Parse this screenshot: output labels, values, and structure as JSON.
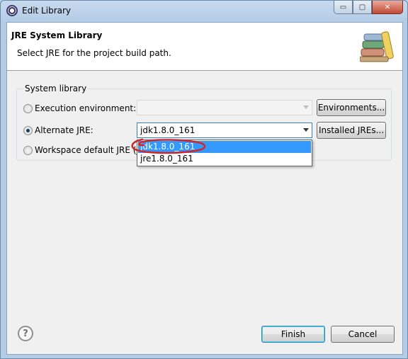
{
  "window": {
    "title": "Edit Library",
    "controls": {
      "minimize": "▭",
      "maximize": "▢",
      "close": "✕"
    }
  },
  "header": {
    "title": "JRE System Library",
    "description": "Select JRE for the project build path."
  },
  "system_library": {
    "group_label": "System library",
    "options": [
      {
        "label": "Execution environment:",
        "selected": false,
        "value": ""
      },
      {
        "label": "Alternate JRE:",
        "selected": true,
        "value": "jdk1.8.0_161"
      },
      {
        "label": "Workspace default JRE (j",
        "selected": false
      }
    ],
    "environments_button": "Environments...",
    "installed_jres_button": "Installed JREs...",
    "dropdown_items": [
      {
        "label": "jdk1.8.0_161",
        "highlighted": true
      },
      {
        "label": "jre1.8.0_161",
        "highlighted": false
      }
    ]
  },
  "footer": {
    "help_glyph": "?",
    "finish_button": "Finish",
    "cancel_button": "Cancel"
  },
  "colors": {
    "selection": "#3399ff",
    "annotation": "#d1262a"
  }
}
